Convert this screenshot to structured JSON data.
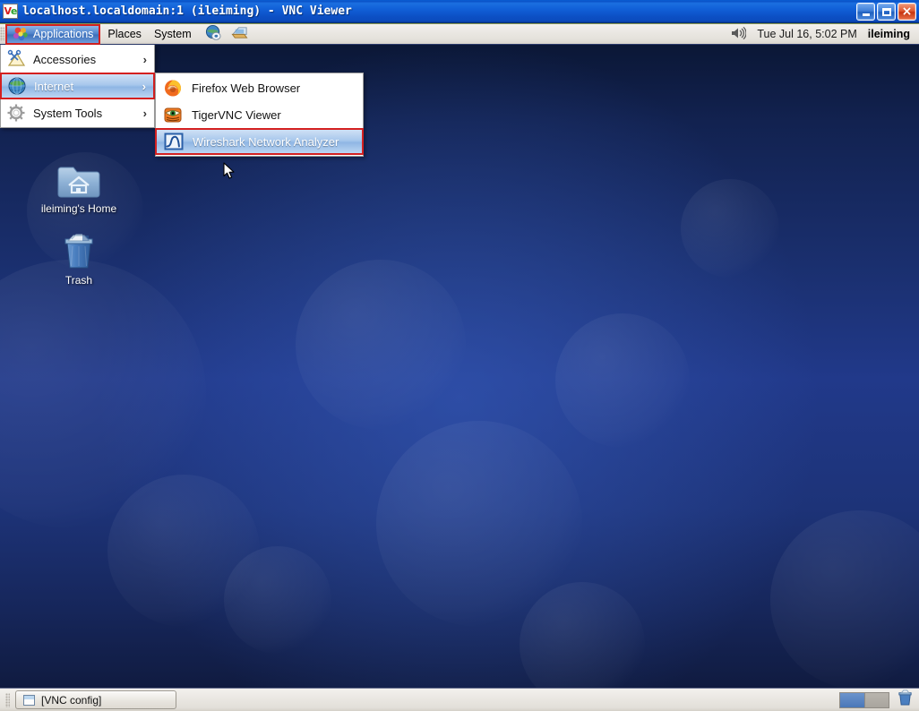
{
  "window": {
    "title": "localhost.localdomain:1 (ileiming) - VNC Viewer",
    "logo_v": "V",
    "logo_c": "e",
    "controls": {
      "minimize": "minimize-button",
      "maximize": "maximize-button",
      "close": "×"
    }
  },
  "top_panel": {
    "applications_label": "Applications",
    "places_label": "Places",
    "system_label": "System",
    "launchers": [
      {
        "name": "web-browser-launcher"
      },
      {
        "name": "email-launcher"
      }
    ],
    "volume_icon": "speaker-icon",
    "clock": "Tue Jul 16,  5:02 PM",
    "user": "ileiming"
  },
  "apps_menu": {
    "items": [
      {
        "label": "Accessories",
        "icon": "accessories-icon",
        "arrow": "›",
        "selected": false
      },
      {
        "label": "Internet",
        "icon": "globe-icon",
        "arrow": "›",
        "selected": true
      },
      {
        "label": "System Tools",
        "icon": "gear-icon",
        "arrow": "›",
        "selected": false
      }
    ]
  },
  "internet_submenu": {
    "items": [
      {
        "label": "Firefox Web Browser",
        "icon": "firefox-icon",
        "selected": false
      },
      {
        "label": "TigerVNC Viewer",
        "icon": "tigervnc-icon",
        "selected": false
      },
      {
        "label": "Wireshark Network Analyzer",
        "icon": "wireshark-icon",
        "selected": true
      }
    ]
  },
  "desktop": {
    "icons": [
      {
        "label": "ileiming's Home",
        "icon": "home-folder-icon"
      },
      {
        "label": "Trash",
        "icon": "trash-icon"
      }
    ]
  },
  "bottom_panel": {
    "task_label": "[VNC config]",
    "task_icon": "window-icon",
    "workspaces": [
      {
        "name": "workspace-1",
        "active": true
      },
      {
        "name": "workspace-2",
        "active": false
      }
    ],
    "trash_applet": "trash-applet-icon"
  },
  "colors": {
    "titlebar_blue": "#0c52c8",
    "selection_blue": "#8fb6e4",
    "highlight_border_red": "#d42020",
    "desktop_navy": "#1a2f6e",
    "panel_gray": "#eae7e2"
  }
}
